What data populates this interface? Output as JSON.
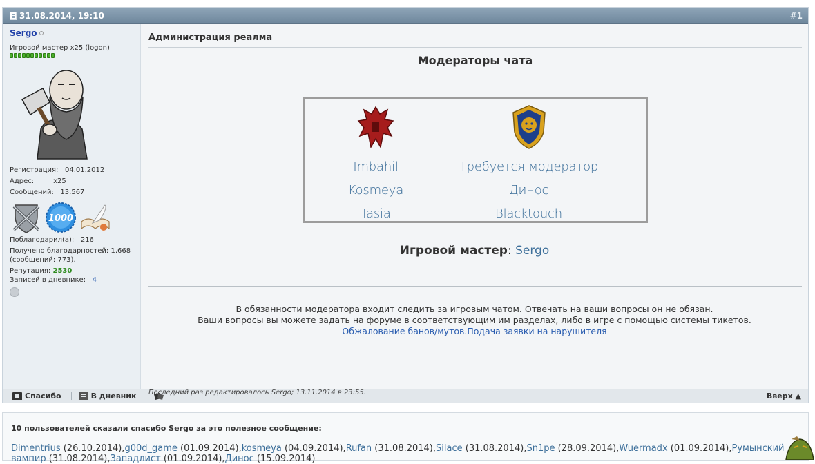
{
  "post": {
    "date": "31.08.2014, 19:10",
    "number": "#1"
  },
  "user": {
    "name": "Sergo",
    "title": "Игровой мастер x25 (logon)",
    "reputation_bars": 11,
    "registration_label": "Регистрация:",
    "registration_value": "04.01.2012",
    "address_label": "Адрес:",
    "address_value": "x25",
    "posts_label": "Сообщений:",
    "posts_value": "13,567",
    "award_1000": "1000",
    "thanked_label": "Поблагодарил(а):",
    "thanked_value": "216",
    "received_label": "Получено благодарностей:",
    "received_value": "1,668",
    "received_posts": "(сообщений: 773).",
    "rep_label": "Репутация:",
    "rep_value": "2530",
    "diary_label": "Записей в дневнике:",
    "diary_value": "4"
  },
  "content": {
    "title": "Администрация реалма",
    "moderators_heading": "Модераторы чата",
    "horde_moderators": [
      "Imbahil",
      "Kosmeya",
      "Tasia"
    ],
    "alliance_moderators": [
      "Требуется модератор",
      "Динос",
      "Blacktouch"
    ],
    "gm_label": "Игровой мастер",
    "gm_colon": ":",
    "gm_name": "Sergo",
    "info_line1": "В обязанности модератора входит следить за игровым чатом. Отвечать на ваши вопросы он не обязан.",
    "info_line2": "Ваши вопросы вы можете задать на форуме в соответствующим им разделах, либо в игре с помощью системы тикетов.",
    "link_appeal": "Обжалование банов/мутов.",
    "link_report": "Подача заявки на нарушителя",
    "edited_note": "Последний раз редактировалось Sergo; 13.11.2014 в 23:55."
  },
  "footer": {
    "thanks_button": "Спасибо",
    "diary_button": "В дневник",
    "top_link": "Вверх ▲"
  },
  "thanks": {
    "title": "10 пользователей сказали спасибо Sergo за это полезное сообщение:",
    "entries": [
      {
        "user": "Dimentrius",
        "date": " (26.10.2014),"
      },
      {
        "user": "g00d_game",
        "date": " (01.09.2014),"
      },
      {
        "user": "kosmeya",
        "date": " (04.09.2014),"
      },
      {
        "user": "Rufan",
        "date": " (31.08.2014),"
      },
      {
        "user": "Silace",
        "date": " (31.08.2014),"
      },
      {
        "user": "Sn1pe",
        "date": " (28.09.2014),"
      },
      {
        "user": "Wuermadx",
        "date": " (01.09.2014),"
      },
      {
        "user": "Румынский вампир",
        "date": " (31.08.2014),"
      },
      {
        "user": "Западлист",
        "date": " (01.09.2014),"
      },
      {
        "user": "Динос",
        "date": " (15.09.2014)"
      }
    ]
  },
  "icons": {
    "horde": "horde-emblem-icon",
    "alliance": "alliance-emblem-icon",
    "colors": {
      "horde_red": "#a61c1c",
      "alliance_blue": "#1d3f8a",
      "alliance_gold": "#d9a21e",
      "link": "#3d6f9a",
      "header": "#7d93a7"
    }
  }
}
